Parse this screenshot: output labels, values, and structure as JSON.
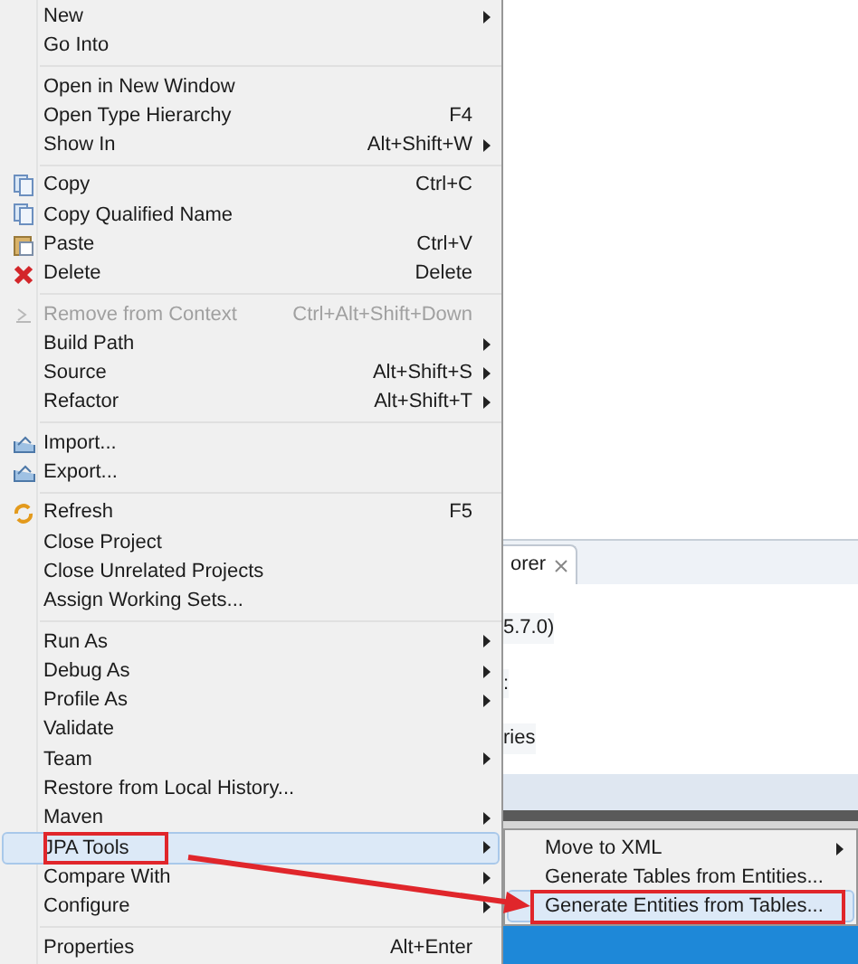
{
  "context_menu": {
    "items": [
      {
        "kind": "item",
        "label": "New",
        "submenu": true,
        "disabled": false,
        "selected": false
      },
      {
        "kind": "item",
        "label": "Go Into",
        "submenu": false,
        "disabled": false,
        "selected": false
      },
      {
        "kind": "separator"
      },
      {
        "kind": "item",
        "label": "Open in New Window",
        "submenu": false,
        "disabled": false,
        "selected": false
      },
      {
        "kind": "item",
        "label": "Open Type Hierarchy",
        "shortcut": "F4",
        "submenu": false,
        "disabled": false,
        "selected": false
      },
      {
        "kind": "item",
        "label": "Show In",
        "shortcut": "Alt+Shift+W",
        "submenu": true,
        "disabled": false,
        "selected": false
      },
      {
        "kind": "separator"
      },
      {
        "kind": "item",
        "label": "Copy",
        "shortcut": "Ctrl+C",
        "submenu": false,
        "disabled": false,
        "selected": false
      },
      {
        "kind": "item",
        "label": "Copy Qualified Name",
        "submenu": false,
        "disabled": false,
        "selected": false
      },
      {
        "kind": "item",
        "label": "Paste",
        "shortcut": "Ctrl+V",
        "submenu": false,
        "disabled": false,
        "selected": false
      },
      {
        "kind": "item",
        "label": "Delete",
        "shortcut": "Delete",
        "submenu": false,
        "disabled": false,
        "selected": false
      },
      {
        "kind": "separator"
      },
      {
        "kind": "item",
        "label": "Remove from Context",
        "shortcut": "Ctrl+Alt+Shift+Down",
        "submenu": false,
        "disabled": true,
        "selected": false
      },
      {
        "kind": "item",
        "label": "Build Path",
        "submenu": true,
        "disabled": false,
        "selected": false
      },
      {
        "kind": "item",
        "label": "Source",
        "shortcut": "Alt+Shift+S",
        "submenu": true,
        "disabled": false,
        "selected": false
      },
      {
        "kind": "item",
        "label": "Refactor",
        "shortcut": "Alt+Shift+T",
        "submenu": true,
        "disabled": false,
        "selected": false
      },
      {
        "kind": "separator"
      },
      {
        "kind": "item",
        "label": "Import...",
        "submenu": false,
        "disabled": false,
        "selected": false
      },
      {
        "kind": "item",
        "label": "Export...",
        "submenu": false,
        "disabled": false,
        "selected": false
      },
      {
        "kind": "separator"
      },
      {
        "kind": "item",
        "label": "Refresh",
        "shortcut": "F5",
        "submenu": false,
        "disabled": false,
        "selected": false
      },
      {
        "kind": "item",
        "label": "Close Project",
        "submenu": false,
        "disabled": false,
        "selected": false
      },
      {
        "kind": "item",
        "label": "Close Unrelated Projects",
        "submenu": false,
        "disabled": false,
        "selected": false
      },
      {
        "kind": "item",
        "label": "Assign Working Sets...",
        "submenu": false,
        "disabled": false,
        "selected": false
      },
      {
        "kind": "separator"
      },
      {
        "kind": "item",
        "label": "Run As",
        "submenu": true,
        "disabled": false,
        "selected": false
      },
      {
        "kind": "item",
        "label": "Debug As",
        "submenu": true,
        "disabled": false,
        "selected": false
      },
      {
        "kind": "item",
        "label": "Profile As",
        "submenu": true,
        "disabled": false,
        "selected": false
      },
      {
        "kind": "item",
        "label": "Validate",
        "submenu": false,
        "disabled": false,
        "selected": false
      },
      {
        "kind": "item",
        "label": "Team",
        "submenu": true,
        "disabled": false,
        "selected": false
      },
      {
        "kind": "item",
        "label": "Restore from Local History...",
        "submenu": false,
        "disabled": false,
        "selected": false
      },
      {
        "kind": "item",
        "label": "Maven",
        "submenu": true,
        "disabled": false,
        "selected": false
      },
      {
        "kind": "item",
        "label": "JPA Tools",
        "submenu": true,
        "disabled": false,
        "selected": true
      },
      {
        "kind": "item",
        "label": "Compare With",
        "submenu": true,
        "disabled": false,
        "selected": false
      },
      {
        "kind": "item",
        "label": "Configure",
        "submenu": true,
        "disabled": false,
        "selected": false
      },
      {
        "kind": "separator"
      },
      {
        "kind": "item",
        "label": "Properties",
        "shortcut": "Alt+Enter",
        "submenu": false,
        "disabled": false,
        "selected": false
      }
    ]
  },
  "view": {
    "tab": "orer",
    "texts": [
      "5.7.0)",
      ":",
      "ries"
    ]
  },
  "submenu": {
    "items": [
      {
        "label": "Move to XML",
        "submenu": true,
        "selected": false
      },
      {
        "label": "Generate Tables from Entities...",
        "submenu": false,
        "selected": false
      },
      {
        "label": "Generate Entities from Tables...",
        "submenu": false,
        "selected": true
      }
    ]
  }
}
